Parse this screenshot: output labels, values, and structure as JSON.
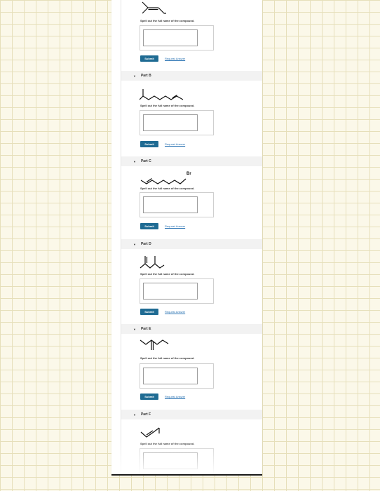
{
  "prompt_text": "Spell out the full name of the compound.",
  "submit_label": "Submit",
  "request_answer_label": "Request Answer",
  "brand_color": "#1f6b93",
  "link_color": "#2a73b3",
  "parts": [
    {
      "title": "",
      "structure_icon": "trisubstituted-alkene-skeletal-structure"
    },
    {
      "title": "Part B",
      "structure_icon": "branched-alkene-skeletal-structure"
    },
    {
      "title": "Part C",
      "structure_icon": "bromoalkene-skeletal-structure",
      "substituent_label": "Br"
    },
    {
      "title": "Part D",
      "structure_icon": "branched-diene-skeletal-structure"
    },
    {
      "title": "Part E",
      "structure_icon": "methylene-alkane-skeletal-structure"
    },
    {
      "title": "Part F",
      "structure_icon": "butene-skeletal-structure"
    }
  ]
}
